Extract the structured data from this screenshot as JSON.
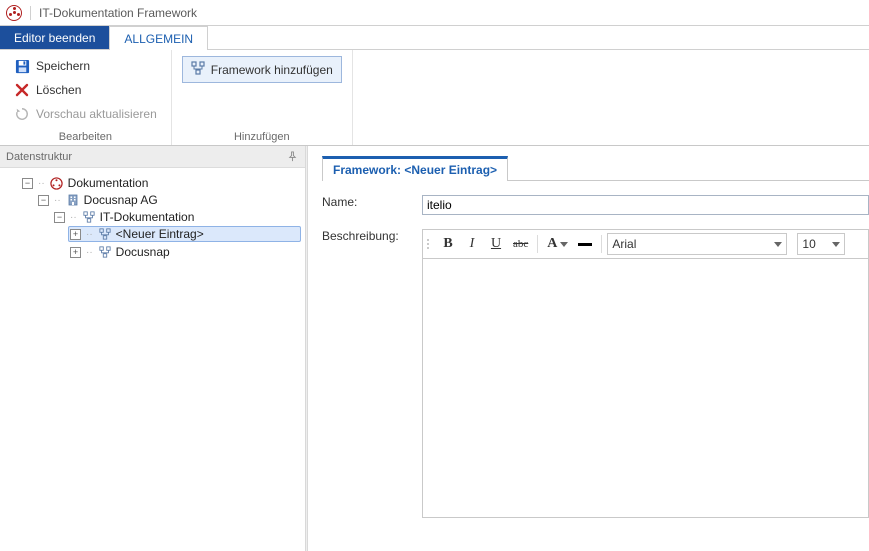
{
  "window": {
    "title": "IT-Dokumentation Framework"
  },
  "ribbon": {
    "exit_tab": "Editor beenden",
    "active_tab": "ALLGEMEIN",
    "group_edit": {
      "save": "Speichern",
      "delete": "Löschen",
      "refresh": "Vorschau aktualisieren",
      "label": "Bearbeiten"
    },
    "group_add": {
      "add_framework": "Framework hinzufügen",
      "label": "Hinzufügen"
    }
  },
  "left": {
    "header": "Datenstruktur",
    "tree": {
      "root": "Dokumentation",
      "org": "Docusnap AG",
      "itdoc": "IT-Dokumentation",
      "new_entry": "<Neuer Eintrag>",
      "docusnap": "Docusnap"
    }
  },
  "content": {
    "tab_title": "Framework: <Neuer Eintrag>",
    "name_label": "Name:",
    "name_value": "itelio",
    "desc_label": "Beschreibung:",
    "rte": {
      "font": "Arial",
      "size": "10"
    }
  }
}
